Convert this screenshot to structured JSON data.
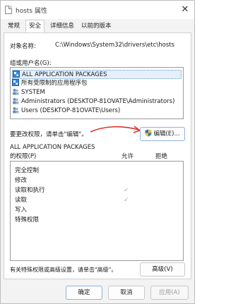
{
  "window": {
    "title": "hosts 属性",
    "close_glyph": "✕"
  },
  "tabs": [
    {
      "label": "常规",
      "active": false
    },
    {
      "label": "安全",
      "active": true
    },
    {
      "label": "详细信息",
      "active": false
    },
    {
      "label": "以前的版本",
      "active": false
    }
  ],
  "object": {
    "label": "对象名称:",
    "value": "C:\\Windows\\System32\\drivers\\etc\\hosts"
  },
  "groups": {
    "label": "组或用户名(G):",
    "items": [
      {
        "label": "ALL APPLICATION PACKAGES",
        "icon": "app-packages-icon",
        "selected": true
      },
      {
        "label": "所有受限制的应用程序包",
        "icon": "app-packages-icon",
        "selected": false
      },
      {
        "label": "SYSTEM",
        "icon": "users-icon",
        "selected": false
      },
      {
        "label": "Administrators (DESKTOP-81OVATE\\Administrators)",
        "icon": "users-icon",
        "selected": false
      },
      {
        "label": "Users (DESKTOP-81OVATE\\Users)",
        "icon": "users-icon",
        "selected": false
      }
    ]
  },
  "edit": {
    "hint": "要更改权限，请单击\"编辑\"。",
    "button_label": "编辑(E)...",
    "icon": "shield-icon"
  },
  "permissions": {
    "title_line1": "ALL APPLICATION PACKAGES",
    "title_line2": "的权限(P)",
    "allow_header": "允许",
    "deny_header": "拒绝",
    "check_glyph": "✓",
    "rows": [
      {
        "label": "完全控制",
        "allow": false,
        "deny": false
      },
      {
        "label": "修改",
        "allow": false,
        "deny": false
      },
      {
        "label": "读取和执行",
        "allow": true,
        "deny": false
      },
      {
        "label": "读取",
        "allow": true,
        "deny": false
      },
      {
        "label": "写入",
        "allow": false,
        "deny": false
      },
      {
        "label": "特殊权限",
        "allow": false,
        "deny": false
      }
    ]
  },
  "advanced": {
    "hint": "有关特殊权限或高级设置，请单击\"高级\"。",
    "button_label": "高级(V)"
  },
  "footer": {
    "ok": "确定",
    "cancel": "取消",
    "apply": "应用(A)"
  },
  "colors": {
    "annotation_arrow": "#d9342b",
    "selection": "#e5f0fb"
  }
}
